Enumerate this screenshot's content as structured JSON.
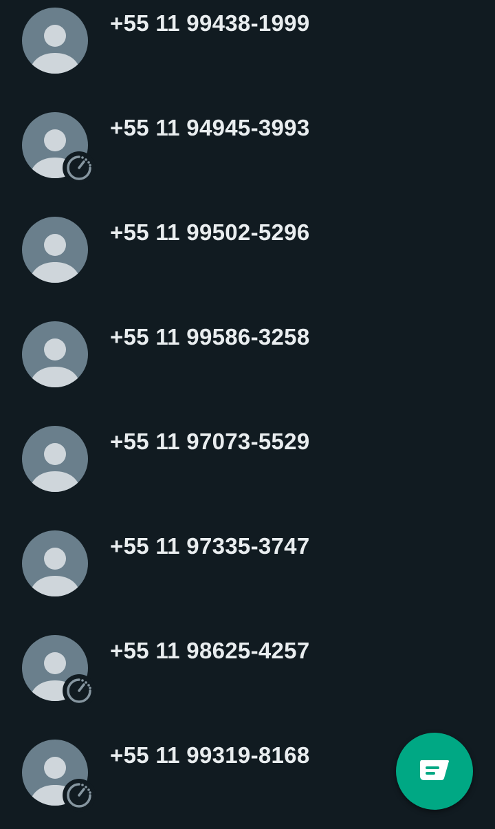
{
  "contacts": [
    {
      "number": "+55 11 99438-1999",
      "disappearing": false
    },
    {
      "number": "+55 11 94945-3993",
      "disappearing": true
    },
    {
      "number": "+55 11 99502-5296",
      "disappearing": false
    },
    {
      "number": "+55 11 99586-3258",
      "disappearing": false
    },
    {
      "number": "+55 11 97073-5529",
      "disappearing": false
    },
    {
      "number": "+55 11 97335-3747",
      "disappearing": false
    },
    {
      "number": "+55 11 98625-4257",
      "disappearing": true
    },
    {
      "number": "+55 11 99319-8168",
      "disappearing": true
    }
  ],
  "icons": {
    "avatar": "default-avatar-icon",
    "timer": "disappearing-messages-timer-icon",
    "fab": "new-chat-icon"
  },
  "colors": {
    "background": "#111b21",
    "avatar_bg": "#6a7f8c",
    "avatar_fg": "#cfd6db",
    "text": "#e9edef",
    "accent": "#00a884"
  }
}
